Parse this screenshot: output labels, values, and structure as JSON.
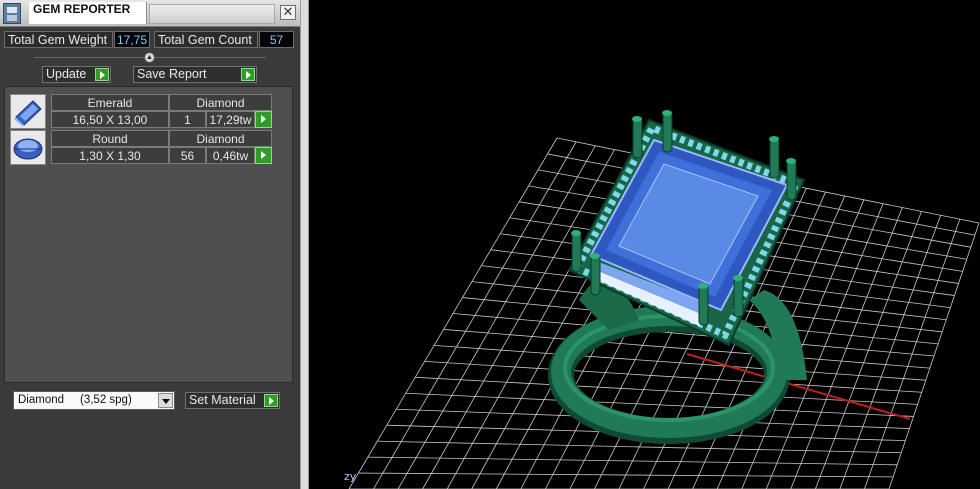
{
  "window": {
    "title": "GEM REPORTER",
    "close_symbol": "✕"
  },
  "stats": {
    "weight_label": "Total Gem Weight",
    "weight_value": "17,75",
    "count_label": "Total Gem Count",
    "count_value": "57"
  },
  "actions": {
    "update_label": "Update",
    "save_label": "Save Report"
  },
  "gems": [
    {
      "shape": "Emerald",
      "material": "Diamond",
      "size": "16,50 X 13,00",
      "count": "1",
      "weight": "17,29tw",
      "icon": "emerald-cut-icon"
    },
    {
      "shape": "Round",
      "material": "Diamond",
      "size": "1,30 X 1,30",
      "count": "56",
      "weight": "0,46tw",
      "icon": "round-cut-icon"
    }
  ],
  "material": {
    "selected": "Diamond     (3,52 spg)",
    "set_label": "Set Material"
  },
  "viewport": {
    "axes_label": "zy",
    "background": "#000000",
    "grid_color": "#c8c8c8",
    "metal_color": "#1f7a55",
    "gem_color": "#4f7fdc",
    "axis_color": "#c0201a"
  }
}
